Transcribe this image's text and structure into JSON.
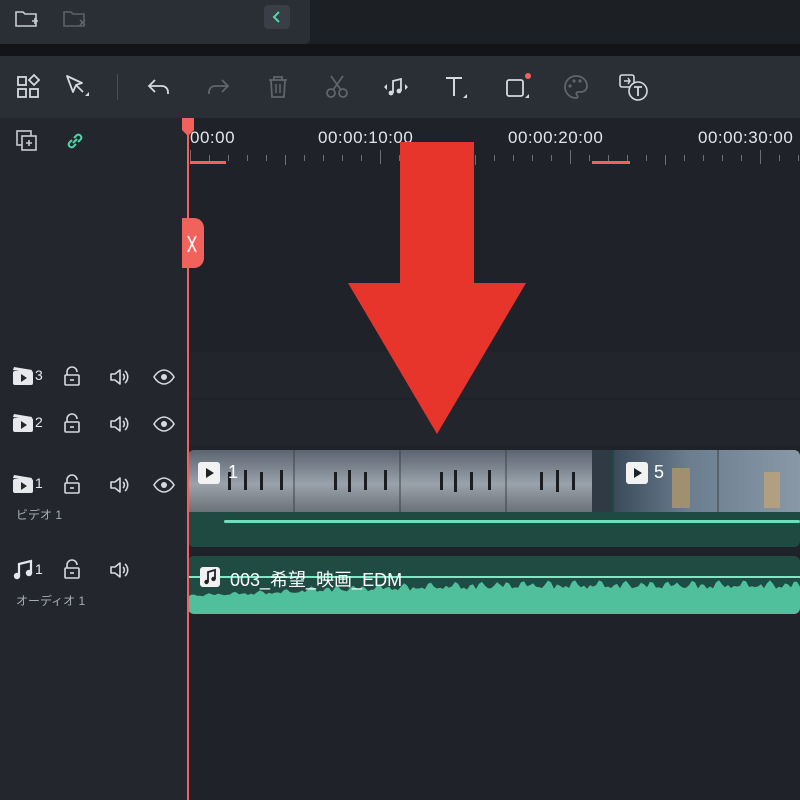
{
  "top_panel": {
    "new_folder_icon": "folder-plus-icon",
    "delete_folder_icon": "folder-delete-icon",
    "collapse_icon": "chevron-left-icon"
  },
  "toolbar": {
    "tools": [
      {
        "name": "layout-grid-icon"
      },
      {
        "name": "select-pointer-icon"
      },
      {
        "name": "undo-icon"
      },
      {
        "name": "redo-icon"
      },
      {
        "name": "delete-icon"
      },
      {
        "name": "cut-icon"
      },
      {
        "name": "audio-adjust-icon"
      },
      {
        "name": "text-icon"
      },
      {
        "name": "crop-icon"
      },
      {
        "name": "color-palette-icon"
      },
      {
        "name": "speech-to-text-icon"
      }
    ]
  },
  "timeline": {
    "time_labels": [
      "00:00",
      "00:00:10:00",
      "00:00:20:00",
      "00:00:30:00"
    ],
    "header_icons": [
      "add-track-icon",
      "link-icon"
    ]
  },
  "tracks": [
    {
      "type": "video",
      "number": "3",
      "sublabel": ""
    },
    {
      "type": "video",
      "number": "2",
      "sublabel": ""
    },
    {
      "type": "video",
      "number": "1",
      "sublabel": "ビデオ 1"
    },
    {
      "type": "audio",
      "number": "1",
      "sublabel": "オーディオ 1"
    }
  ],
  "clips": {
    "video_clip_1_label": "1",
    "video_clip_2_label": "5",
    "audio_clip_label": "003_希望_映画_EDM"
  },
  "colors": {
    "playhead": "#f0625b",
    "arrow": "#e8352b",
    "clip_bg": "#1e4a42",
    "waveform": "#4fbf9c",
    "accent_link": "#4fd6a8"
  }
}
